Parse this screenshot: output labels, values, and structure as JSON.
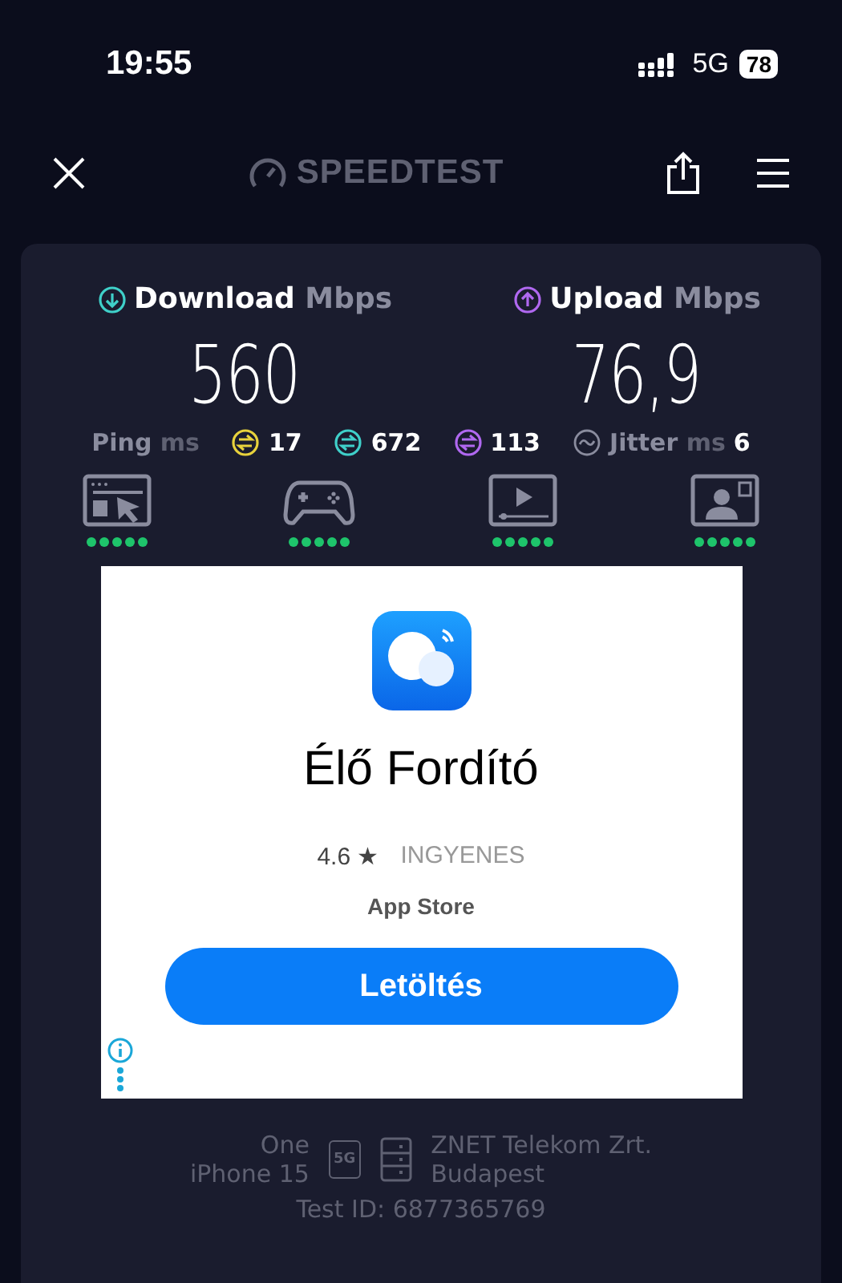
{
  "status_bar": {
    "time": "19:55",
    "network": "5G",
    "battery": "78"
  },
  "toolbar": {
    "logo": "SPEEDTEST"
  },
  "results": [
    {
      "kind": "download",
      "label": "Download",
      "unit": "Mbps",
      "value": "560",
      "color": "#3fd0c9"
    },
    {
      "kind": "upload",
      "label": "Upload",
      "unit": "Mbps",
      "value": "76,9",
      "color": "#b068f0"
    }
  ],
  "ping": {
    "label": "Ping",
    "unit": "ms",
    "values": [
      {
        "value": "17",
        "color": "#e8d23c"
      },
      {
        "value": "672",
        "color": "#3fd0c9"
      },
      {
        "value": "113",
        "color": "#b068f0"
      }
    ]
  },
  "jitter": {
    "label": "Jitter",
    "unit": "ms",
    "value": "6"
  },
  "quality": [
    {
      "kind": "browsing",
      "stars": 5
    },
    {
      "kind": "gaming",
      "stars": 5
    },
    {
      "kind": "video",
      "stars": 5
    },
    {
      "kind": "videochat",
      "stars": 5
    }
  ],
  "ad": {
    "title": "Élő Fordító",
    "rating": "4.6 ★",
    "price": "INGYENES",
    "store": "App Store",
    "button": "Letöltés"
  },
  "footer": {
    "carrier": "One",
    "device": "iPhone 15",
    "network_badge": "5G",
    "provider": "ZNET Telekom Zrt.",
    "city": "Budapest",
    "test_id": "Test ID: 6877365769"
  }
}
